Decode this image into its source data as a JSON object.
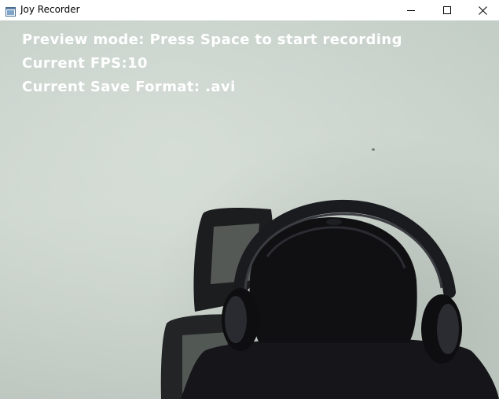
{
  "window": {
    "title": "Joy Recorder",
    "icon": "app-window-icon",
    "controls": [
      "minimize-icon",
      "maximize-icon",
      "close-icon"
    ]
  },
  "overlay": {
    "mode_line": "Preview mode: Press Space to start recording",
    "fps_line": "Current FPS:10",
    "format_line": "Current Save Format: .avi"
  },
  "colors": {
    "overlay_text": "#ffffff",
    "wall": "#c9d3cb",
    "titlebar": "#ffffff"
  }
}
